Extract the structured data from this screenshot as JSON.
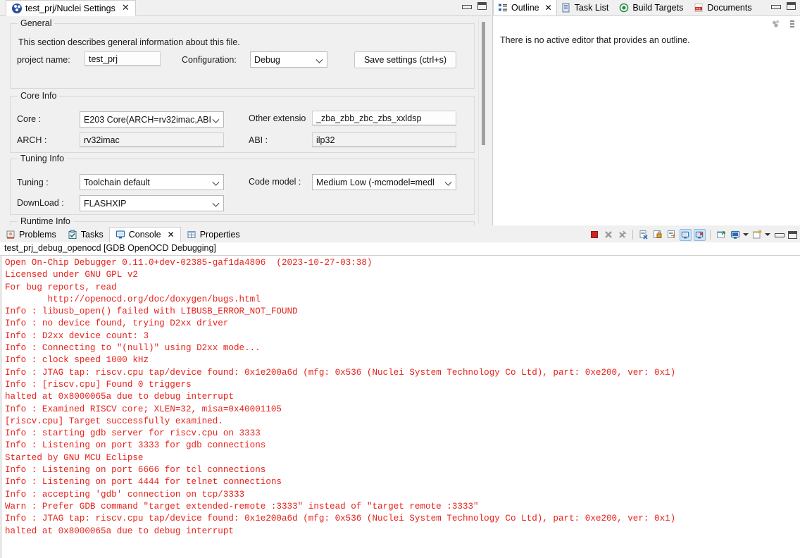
{
  "editor": {
    "tab": {
      "label": "test_prj/Nuclei Settings",
      "icon": "nuclei-icon",
      "close": "✕"
    },
    "window_buttons": {
      "minimize": "minimize-icon",
      "maximize": "maximize-icon"
    },
    "groups": {
      "general": {
        "legend": "General",
        "description": "This section describes general information about this file.",
        "project_name_label": "project name:",
        "project_name_value": "test_prj",
        "configuration_label": "Configuration:",
        "configuration_value": "Debug",
        "save_button": "Save settings (ctrl+s)"
      },
      "core_info": {
        "legend": "Core Info",
        "core_label": "Core :",
        "core_value": "E203 Core(ARCH=rv32imac,ABI",
        "arch_label": "ARCH :",
        "arch_value": "rv32imac",
        "other_ext_label": "Other extensio",
        "other_ext_value": "_zba_zbb_zbc_zbs_xxldsp",
        "abi_label": "ABI :",
        "abi_value": "ilp32"
      },
      "tuning_info": {
        "legend": "Tuning Info",
        "tuning_label": "Tuning :",
        "tuning_value": "Toolchain default",
        "download_label": "DownLoad :",
        "download_value": "FLASHXIP",
        "code_model_label": "Code model :",
        "code_model_value": "Medium Low (-mcmodel=medl"
      },
      "runtime_info": {
        "legend": "Runtime Info"
      }
    }
  },
  "outline": {
    "tabs": [
      {
        "label": "Outline",
        "icon": "outline-icon",
        "active": true,
        "close": "✕"
      },
      {
        "label": "Task List",
        "icon": "task-list-icon",
        "active": false
      },
      {
        "label": "Build Targets",
        "icon": "build-targets-icon",
        "active": false
      },
      {
        "label": "Documents",
        "icon": "pdf-documents-icon",
        "active": false
      }
    ],
    "message": "There is no active editor that provides an outline.",
    "window_buttons": {
      "minimize": "minimize-icon",
      "maximize": "maximize-icon"
    },
    "toolbar": [
      {
        "name": "collapse-all-icon"
      },
      {
        "name": "view-menu-icon"
      }
    ]
  },
  "console": {
    "tabs": [
      {
        "label": "Problems",
        "icon": "problems-icon",
        "active": false
      },
      {
        "label": "Tasks",
        "icon": "tasks-icon",
        "active": false
      },
      {
        "label": "Console",
        "icon": "console-icon",
        "active": true,
        "close": "✕"
      },
      {
        "label": "Properties",
        "icon": "properties-icon",
        "active": false
      }
    ],
    "toolbar": [
      {
        "name": "terminate-icon",
        "selected": false
      },
      {
        "name": "remove-launch-icon",
        "selected": false
      },
      {
        "name": "remove-all-terminated-icon",
        "selected": false
      },
      {
        "name": "clear-console-icon",
        "selected": false
      },
      {
        "name": "scroll-lock-icon",
        "selected": false
      },
      {
        "name": "word-wrap-icon",
        "selected": false
      },
      {
        "name": "show-console-on-output-icon",
        "selected": true
      },
      {
        "name": "show-console-on-error-icon",
        "selected": true
      },
      {
        "name": "pin-console-icon",
        "selected": false
      },
      {
        "name": "display-selected-console-icon",
        "selected": false
      },
      {
        "name": "open-console-icon",
        "selected": false
      }
    ],
    "title": "test_prj_debug_openocd [GDB OpenOCD Debugging]",
    "text_color": "#e8221c",
    "lines": [
      "Open On-Chip Debugger 0.11.0+dev-02385-gaf1da4806  (2023-10-27-03:38)",
      "Licensed under GNU GPL v2",
      "For bug reports, read",
      "        http://openocd.org/doc/doxygen/bugs.html",
      "Info : libusb_open() failed with LIBUSB_ERROR_NOT_FOUND",
      "Info : no device found, trying D2xx driver",
      "Info : D2xx device count: 3",
      "Info : Connecting to \"(null)\" using D2xx mode...",
      "Info : clock speed 1000 kHz",
      "Info : JTAG tap: riscv.cpu tap/device found: 0x1e200a6d (mfg: 0x536 (Nuclei System Technology Co Ltd), part: 0xe200, ver: 0x1)",
      "Info : [riscv.cpu] Found 0 triggers",
      "halted at 0x8000065a due to debug interrupt",
      "Info : Examined RISCV core; XLEN=32, misa=0x40001105",
      "[riscv.cpu] Target successfully examined.",
      "Info : starting gdb server for riscv.cpu on 3333",
      "Info : Listening on port 3333 for gdb connections",
      "Started by GNU MCU Eclipse",
      "Info : Listening on port 6666 for tcl connections",
      "Info : Listening on port 4444 for telnet connections",
      "Info : accepting 'gdb' connection on tcp/3333",
      "Warn : Prefer GDB command \"target extended-remote :3333\" instead of \"target remote :3333\"",
      "Info : JTAG tap: riscv.cpu tap/device found: 0x1e200a6d (mfg: 0x536 (Nuclei System Technology Co Ltd), part: 0xe200, ver: 0x1)",
      "halted at 0x8000065a due to debug interrupt"
    ]
  }
}
